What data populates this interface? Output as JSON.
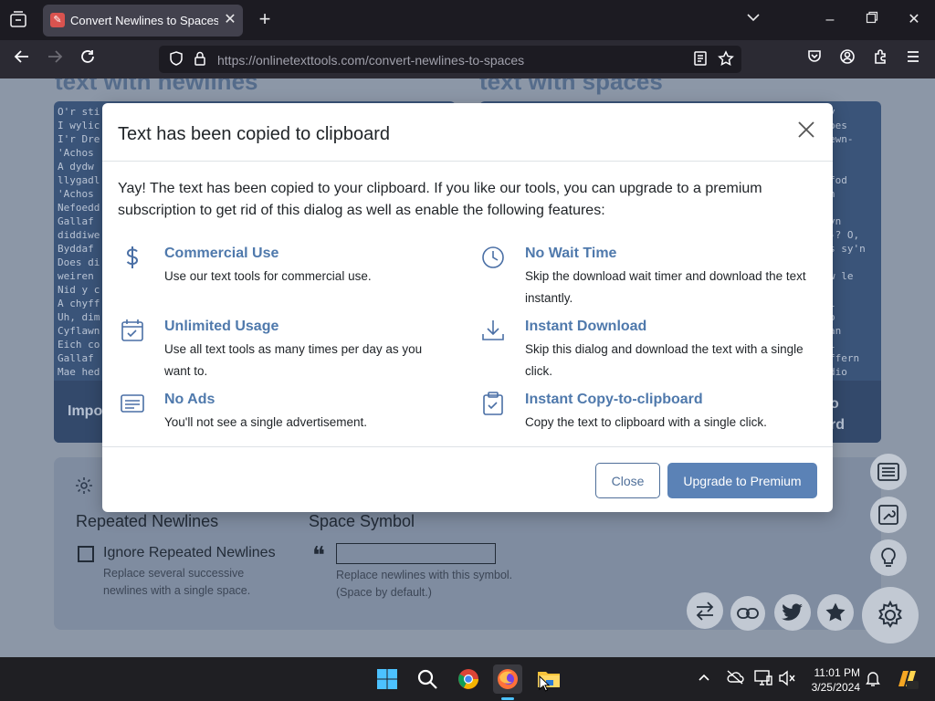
{
  "browser": {
    "tab_title": "Convert Newlines to Spaces in Text",
    "url_host": "https://onlinetexttools.com",
    "url_path": "/convert-newlines-to-spaces"
  },
  "page": {
    "input_heading": "text with newlines",
    "output_heading": "text with spaces",
    "input_text": "O'r sti\nI wylic\nI'r Dre\n'Achos\nA dydw\nllygadl\n'Achos\nNefoedd\nGallaf\ndiddiwe\nByddaf\nDoes di\nweiren\nNid y c\nA chyff\nUh, dim\nCyflawn\nEich co\nGallaf\nMae hed",
    "output_text": "y\noes\newn-\n\n\nfod\nn\n\nyn\n-? O,\ns sy'n\n\nw le\n\nl\no\nan\nl\nffern\ndio",
    "input_footer": "Impo",
    "output_footer_1": "o",
    "output_footer_2": "rd",
    "options": {
      "newlines_title": "Repeated Newlines",
      "ignore_label": "Ignore Repeated Newlines",
      "ignore_desc": "Replace several successive newlines with a single space.",
      "symbol_title": "Space Symbol",
      "symbol_value": "",
      "symbol_desc": "Replace newlines with this symbol. (Space by default.)"
    }
  },
  "modal": {
    "title": "Text has been copied to clipboard",
    "intro": "Yay! The text has been copied to your clipboard. If you like our tools, you can upgrade to a premium subscription to get rid of this dialog as well as enable the following features:",
    "features": [
      {
        "title": "Commercial Use",
        "desc": "Use our text tools for commercial use.",
        "icon": "dollar-icon"
      },
      {
        "title": "No Wait Time",
        "desc": "Skip the download wait timer and download the text instantly.",
        "icon": "clock-icon"
      },
      {
        "title": "Unlimited Usage",
        "desc": "Use all text tools as many times per day as you want to.",
        "icon": "calendar-check-icon"
      },
      {
        "title": "Instant Download",
        "desc": "Skip this dialog and download the text with a single click.",
        "icon": "download-icon"
      },
      {
        "title": "No Ads",
        "desc": "You'll not see a single advertisement.",
        "icon": "no-ads-icon"
      },
      {
        "title": "Instant Copy-to-clipboard",
        "desc": "Copy the text to clipboard with a single click.",
        "icon": "clipboard-check-icon"
      }
    ],
    "close_label": "Close",
    "upgrade_label": "Upgrade to Premium"
  },
  "taskbar": {
    "time": "11:01 PM",
    "date": "3/25/2024"
  },
  "colors": {
    "accent": "#5b82b6",
    "feature_title": "#4f79ac",
    "panel": "#3a5479"
  }
}
